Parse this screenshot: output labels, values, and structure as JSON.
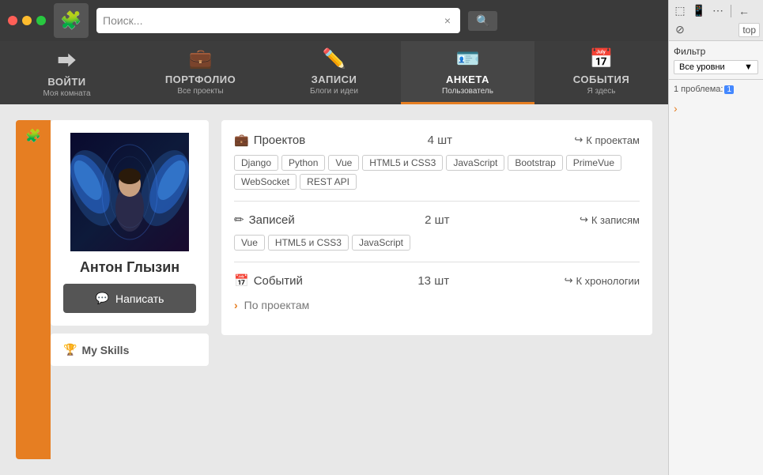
{
  "window": {
    "controls": [
      "red",
      "yellow",
      "green"
    ]
  },
  "topbar": {
    "search_placeholder": "Поиск...",
    "search_value": "Поиск...",
    "search_clear": "×",
    "search_btn_icon": "🔍"
  },
  "nav": {
    "tabs": [
      {
        "id": "login",
        "icon": "⬅",
        "title": "ВОЙТИ",
        "sub": "Моя комната",
        "active": false
      },
      {
        "id": "portfolio",
        "icon": "💼",
        "title": "ПОРТФОЛИО",
        "sub": "Все проекты",
        "active": false
      },
      {
        "id": "records",
        "icon": "✏",
        "title": "ЗАПИСИ",
        "sub": "Блоги и идеи",
        "active": false
      },
      {
        "id": "profile",
        "icon": "👤",
        "title": "АНКЕТА",
        "sub": "Пользователь",
        "active": true
      },
      {
        "id": "events",
        "icon": "📅",
        "title": "СОБЫТИЯ",
        "sub": "Я здесь",
        "active": false
      }
    ]
  },
  "profile": {
    "name": "Антон Глызин",
    "write_btn": "Написать",
    "write_icon": "💬",
    "skills_title": "My Skills",
    "skills_icon": "🏆"
  },
  "projects_section": {
    "icon": "💼",
    "title": "Проектов",
    "count": "4 шт",
    "link": "К проектам",
    "link_icon": "↪",
    "tags": [
      "Django",
      "Python",
      "Vue",
      "HTML5 и CSS3",
      "JavaScript",
      "Bootstrap",
      "PrimeVue",
      "WebSocket",
      "REST API"
    ]
  },
  "records_section": {
    "icon": "✏",
    "title": "Записей",
    "count": "2 шт",
    "link": "К записям",
    "link_icon": "↪",
    "tags": [
      "Vue",
      "HTML5 и CSS3",
      "JavaScript"
    ]
  },
  "events_section": {
    "icon": "📅",
    "title": "Событий",
    "count": "13 шт",
    "link": "К хронологии",
    "link_icon": "↪",
    "expand_text": "По проектам"
  },
  "devtools": {
    "top_text": "top",
    "filter_label": "Фильтр",
    "filter_value": "Все уровни",
    "filter_arrow": "▼",
    "problems_label": "1 проблема:",
    "problems_badge": "1"
  }
}
